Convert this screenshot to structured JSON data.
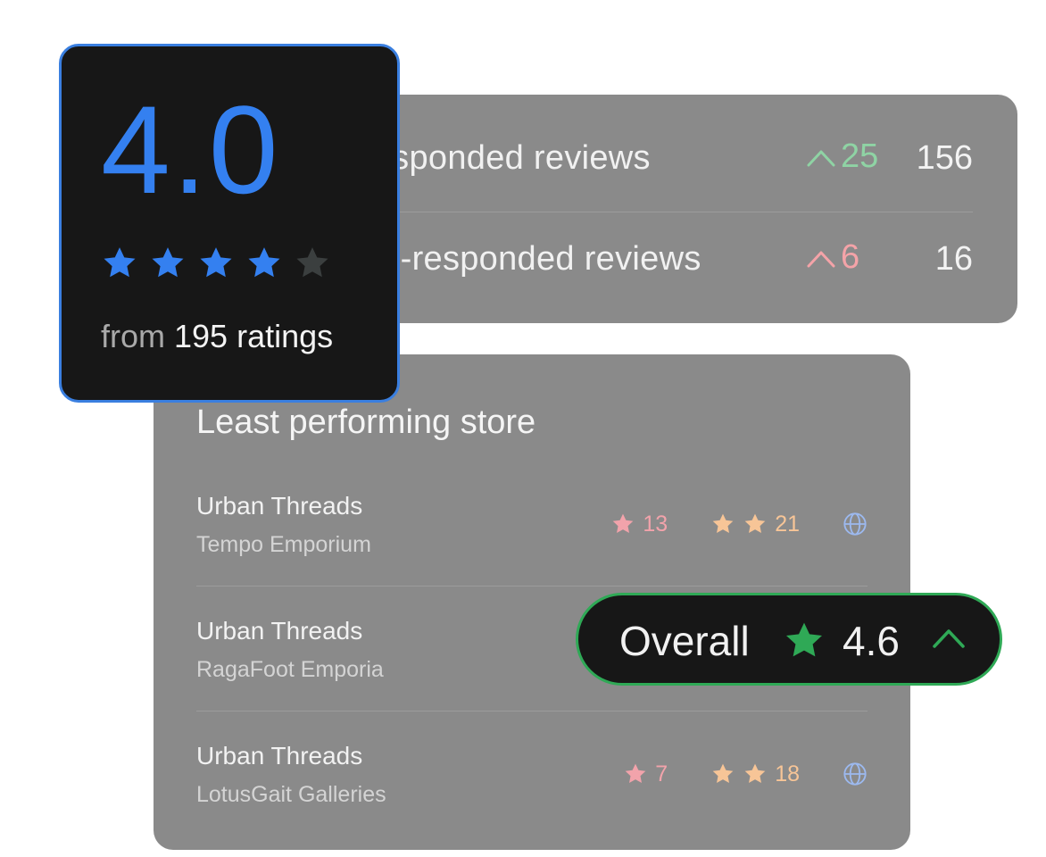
{
  "reviews": {
    "rows": [
      {
        "label": "Responded reviews",
        "delta": "25",
        "total": "156",
        "trend": "up"
      },
      {
        "label": "Non-responded reviews",
        "delta": "6",
        "total": "16",
        "trend": "up"
      }
    ]
  },
  "rating_card": {
    "value": "4.0",
    "stars": 4,
    "max_stars": 5,
    "from_prefix": "from",
    "ratings_count_text": "195 ratings"
  },
  "store_panel": {
    "title": "Least performing store",
    "rows": [
      {
        "name": "Urban Threads",
        "sub": "Tempo Emporium",
        "one_star": "13",
        "two_star": "21"
      },
      {
        "name": "Urban Threads",
        "sub": "RagaFoot Emporia"
      },
      {
        "name": "Urban Threads",
        "sub": "LotusGait Galleries",
        "one_star": "7",
        "two_star": "18"
      }
    ]
  },
  "overall": {
    "label": "Overall",
    "value": "4.6",
    "trend": "up"
  },
  "colors": {
    "accent_blue": "#3480f0",
    "accent_green": "#2fa956",
    "delta_green": "#8fd3a4",
    "delta_red": "#f4a3a8",
    "metric_pink": "#f2a3ab",
    "metric_orange": "#f7c597",
    "globe_blue": "#9cb9ef",
    "panel_gray": "#8a8a8a",
    "card_dark": "#171717"
  },
  "icons": {
    "star": "star-icon",
    "empty_star": "star-empty-icon",
    "trend_up": "chevron-up-icon",
    "globe": "globe-icon"
  }
}
